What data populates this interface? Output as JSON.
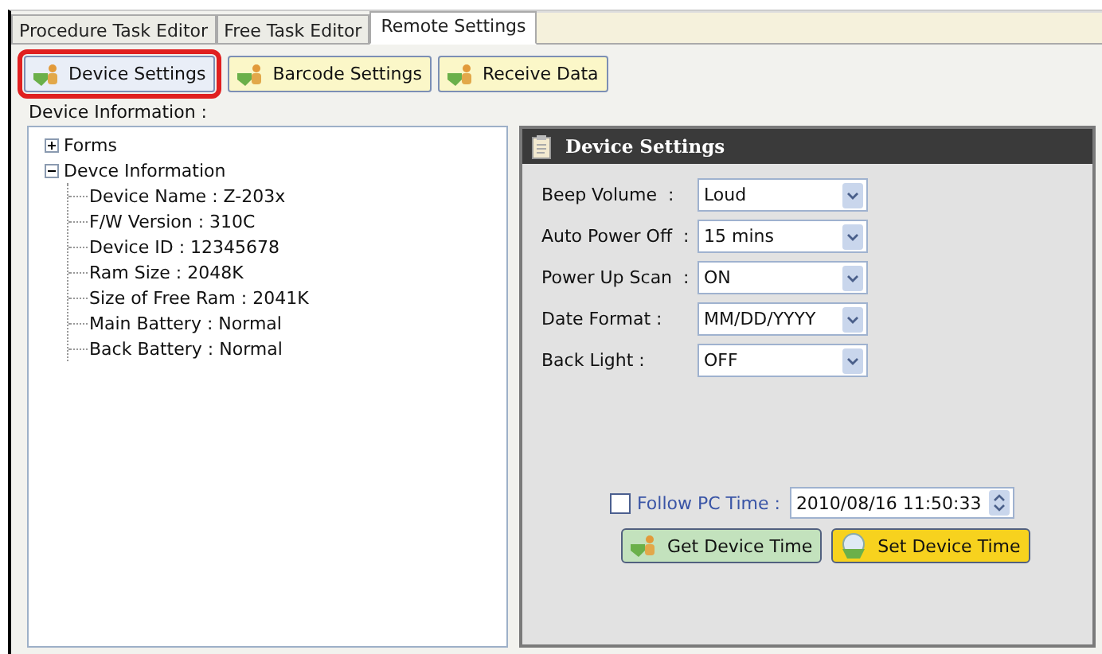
{
  "tabs": [
    {
      "label": "Procedure Task Editor",
      "selected": false
    },
    {
      "label": "Free Task Editor",
      "selected": false
    },
    {
      "label": "Remote Settings",
      "selected": true
    }
  ],
  "toolbar": [
    {
      "label": "Device Settings",
      "selected": true
    },
    {
      "label": "Barcode Settings",
      "selected": false
    },
    {
      "label": "Receive Data",
      "selected": false
    }
  ],
  "tree_label": "Device Information :",
  "tree": [
    {
      "label": "Forms",
      "expanded": false
    },
    {
      "label": "Devce Information",
      "expanded": true,
      "children": [
        {
          "label": "Device Name : Z-203x"
        },
        {
          "label": "F/W Version : 310C"
        },
        {
          "label": "Device ID : 12345678"
        },
        {
          "label": "Ram Size : 2048K"
        },
        {
          "label": "Size of Free Ram : 2041K"
        },
        {
          "label": "Main Battery : Normal"
        },
        {
          "label": "Back Battery : Normal"
        }
      ]
    }
  ],
  "panel": {
    "title": "Device Settings",
    "settings": [
      {
        "label": "Beep Volume  :",
        "value": "Loud"
      },
      {
        "label": "Auto Power Off  :",
        "value": "15 mins"
      },
      {
        "label": "Power Up Scan  :",
        "value": "ON"
      },
      {
        "label": "Date Format :",
        "value": "MM/DD/YYYY"
      },
      {
        "label": "Back Light :",
        "value": "OFF"
      }
    ],
    "follow_pc_time": {
      "label": "Follow PC Time :",
      "checked": false,
      "value": "2010/08/16 11:50:33"
    },
    "buttons": [
      {
        "label": "Get Device Time",
        "color": "#c3e2bd",
        "kind": "get"
      },
      {
        "label": "Set Device Time",
        "color": "#f7d21e",
        "kind": "set"
      }
    ]
  }
}
